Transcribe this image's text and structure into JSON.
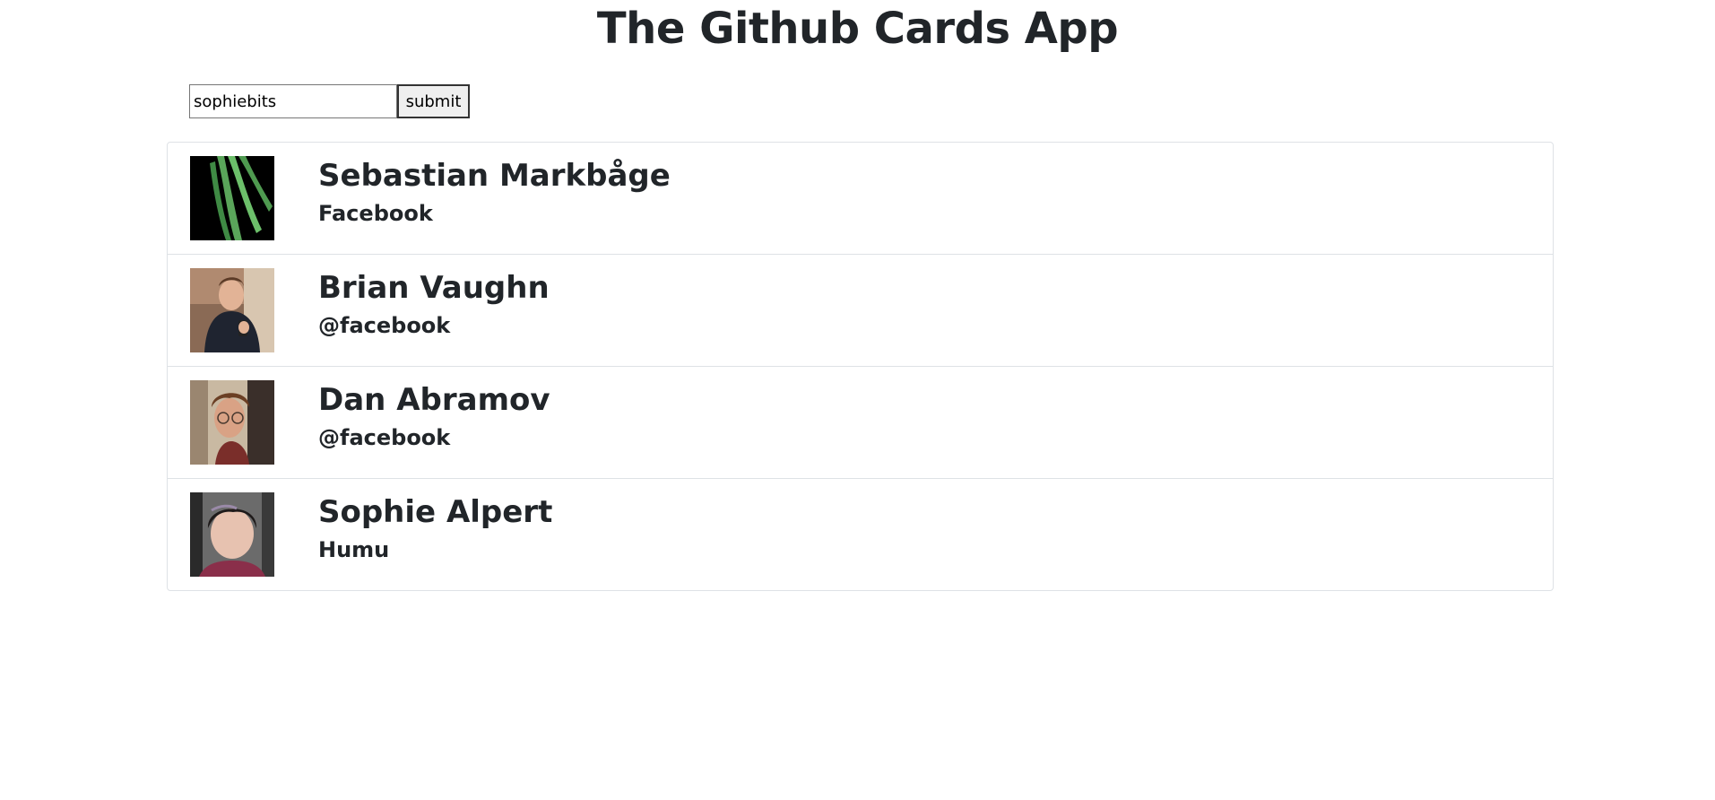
{
  "header": {
    "title": "The Github Cards App"
  },
  "search": {
    "value": "sophiebits",
    "submit_label": "submit"
  },
  "cards": [
    {
      "name": "Sebastian Markbåge",
      "company": "Facebook"
    },
    {
      "name": "Brian Vaughn",
      "company": "@facebook"
    },
    {
      "name": "Dan Abramov",
      "company": "@facebook"
    },
    {
      "name": "Sophie Alpert",
      "company": "Humu"
    }
  ]
}
